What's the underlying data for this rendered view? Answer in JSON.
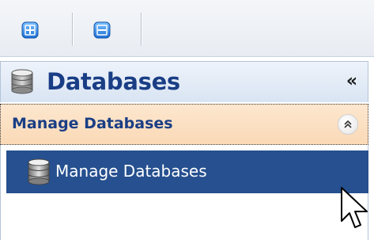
{
  "toolbar": {
    "buttons": [
      {
        "icon": "expand-all-icon"
      },
      {
        "icon": "collapse-all-icon"
      }
    ]
  },
  "panel": {
    "title": "Databases",
    "icon": "database-icon",
    "collapse_glyph": "«"
  },
  "section": {
    "title": "Manage Databases",
    "toggle_icon": "chevron-double-up-icon"
  },
  "items": [
    {
      "label": "Manage Databases",
      "icon": "database-icon",
      "selected": true
    }
  ],
  "colors": {
    "panel_title": "#1a3e85",
    "section_bg": "#fad9b6",
    "selected_bg": "#26508f",
    "selected_text": "#ffffff"
  }
}
